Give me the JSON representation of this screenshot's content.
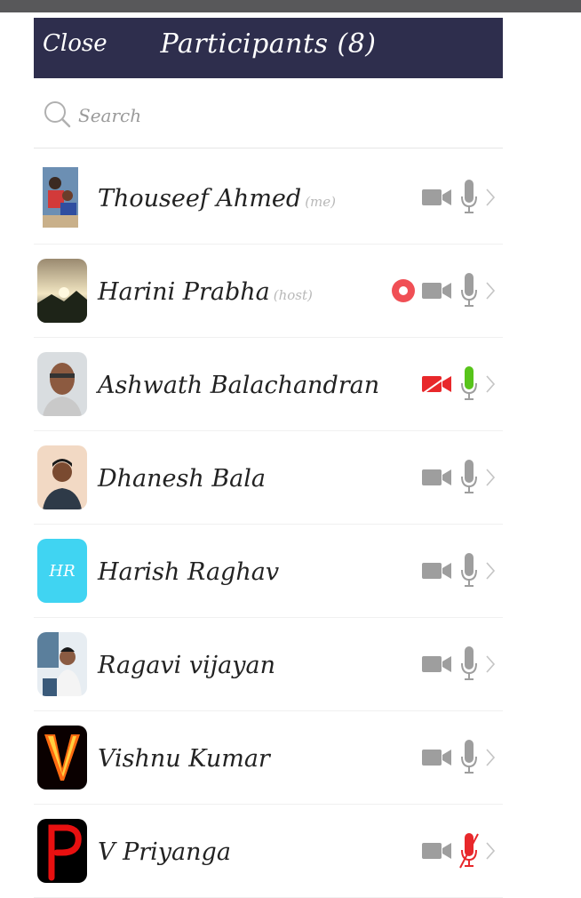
{
  "header": {
    "close_label": "Close",
    "title": "Participants (8)"
  },
  "search": {
    "placeholder": "Search"
  },
  "colors": {
    "header_bg": "#2e2e4d",
    "icon_gray": "#9e9e9e",
    "mute_red": "#e8282b",
    "speaking_green": "#57c41a",
    "record_red": "#f04f55",
    "initials_bg": "#40d4f2"
  },
  "participants": [
    {
      "name": "Thouseef Ahmed",
      "tag": "(me)",
      "avatar": "photo",
      "video": "on",
      "mic": "idle",
      "recording": false
    },
    {
      "name": "Harini Prabha",
      "tag": "(host)",
      "avatar": "photo",
      "video": "on",
      "mic": "idle",
      "recording": true
    },
    {
      "name": "Ashwath Balachandran",
      "tag": "",
      "avatar": "photo",
      "video": "off",
      "mic": "speaking",
      "recording": false
    },
    {
      "name": "Dhanesh Bala",
      "tag": "",
      "avatar": "photo",
      "video": "on",
      "mic": "idle",
      "recording": false
    },
    {
      "name": "Harish Raghav",
      "tag": "",
      "avatar": "initials",
      "initials": "HR",
      "video": "on",
      "mic": "idle",
      "recording": false
    },
    {
      "name": "Ragavi vijayan",
      "tag": "",
      "avatar": "photo",
      "video": "on",
      "mic": "idle",
      "recording": false
    },
    {
      "name": "Vishnu Kumar",
      "tag": "",
      "avatar": "photo",
      "video": "on",
      "mic": "idle",
      "recording": false
    },
    {
      "name": "V Priyanga",
      "tag": "",
      "avatar": "photo",
      "video": "on",
      "mic": "muted",
      "recording": false
    }
  ]
}
